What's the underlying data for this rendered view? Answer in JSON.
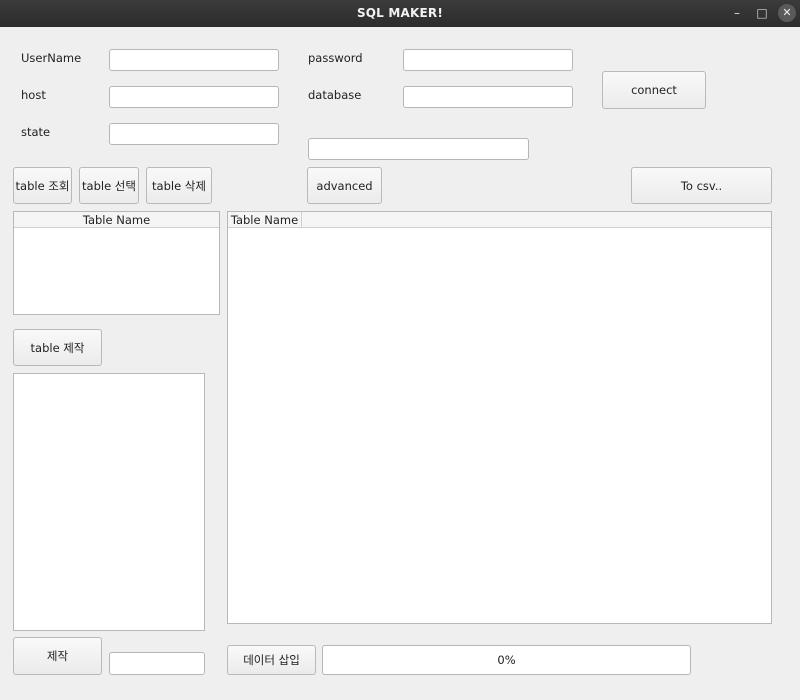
{
  "window": {
    "title": "SQL MAKER!",
    "min_glyph": "–",
    "max_glyph": "□",
    "close_glyph": "✕"
  },
  "connection": {
    "username_label": "UserName",
    "username_value": "",
    "password_label": "password",
    "password_value": "",
    "host_label": "host",
    "host_value": "",
    "database_label": "database",
    "database_value": "",
    "state_label": "state",
    "state_value": "",
    "extra_value": "",
    "connect_label": "connect"
  },
  "toolbar": {
    "table_query_label": "table 조회",
    "table_select_label": "table 선택",
    "table_delete_label": "table 삭제",
    "advanced_label": "advanced",
    "to_csv_label": "To csv.."
  },
  "tables": {
    "list_header": "Table Name",
    "view_header": "Table Name",
    "rows": []
  },
  "create": {
    "table_create_label": "table 제작",
    "make_label": "제작",
    "make_value": ""
  },
  "insert": {
    "insert_label": "데이터 삽입",
    "progress_text": "0%",
    "progress_value": 0
  }
}
